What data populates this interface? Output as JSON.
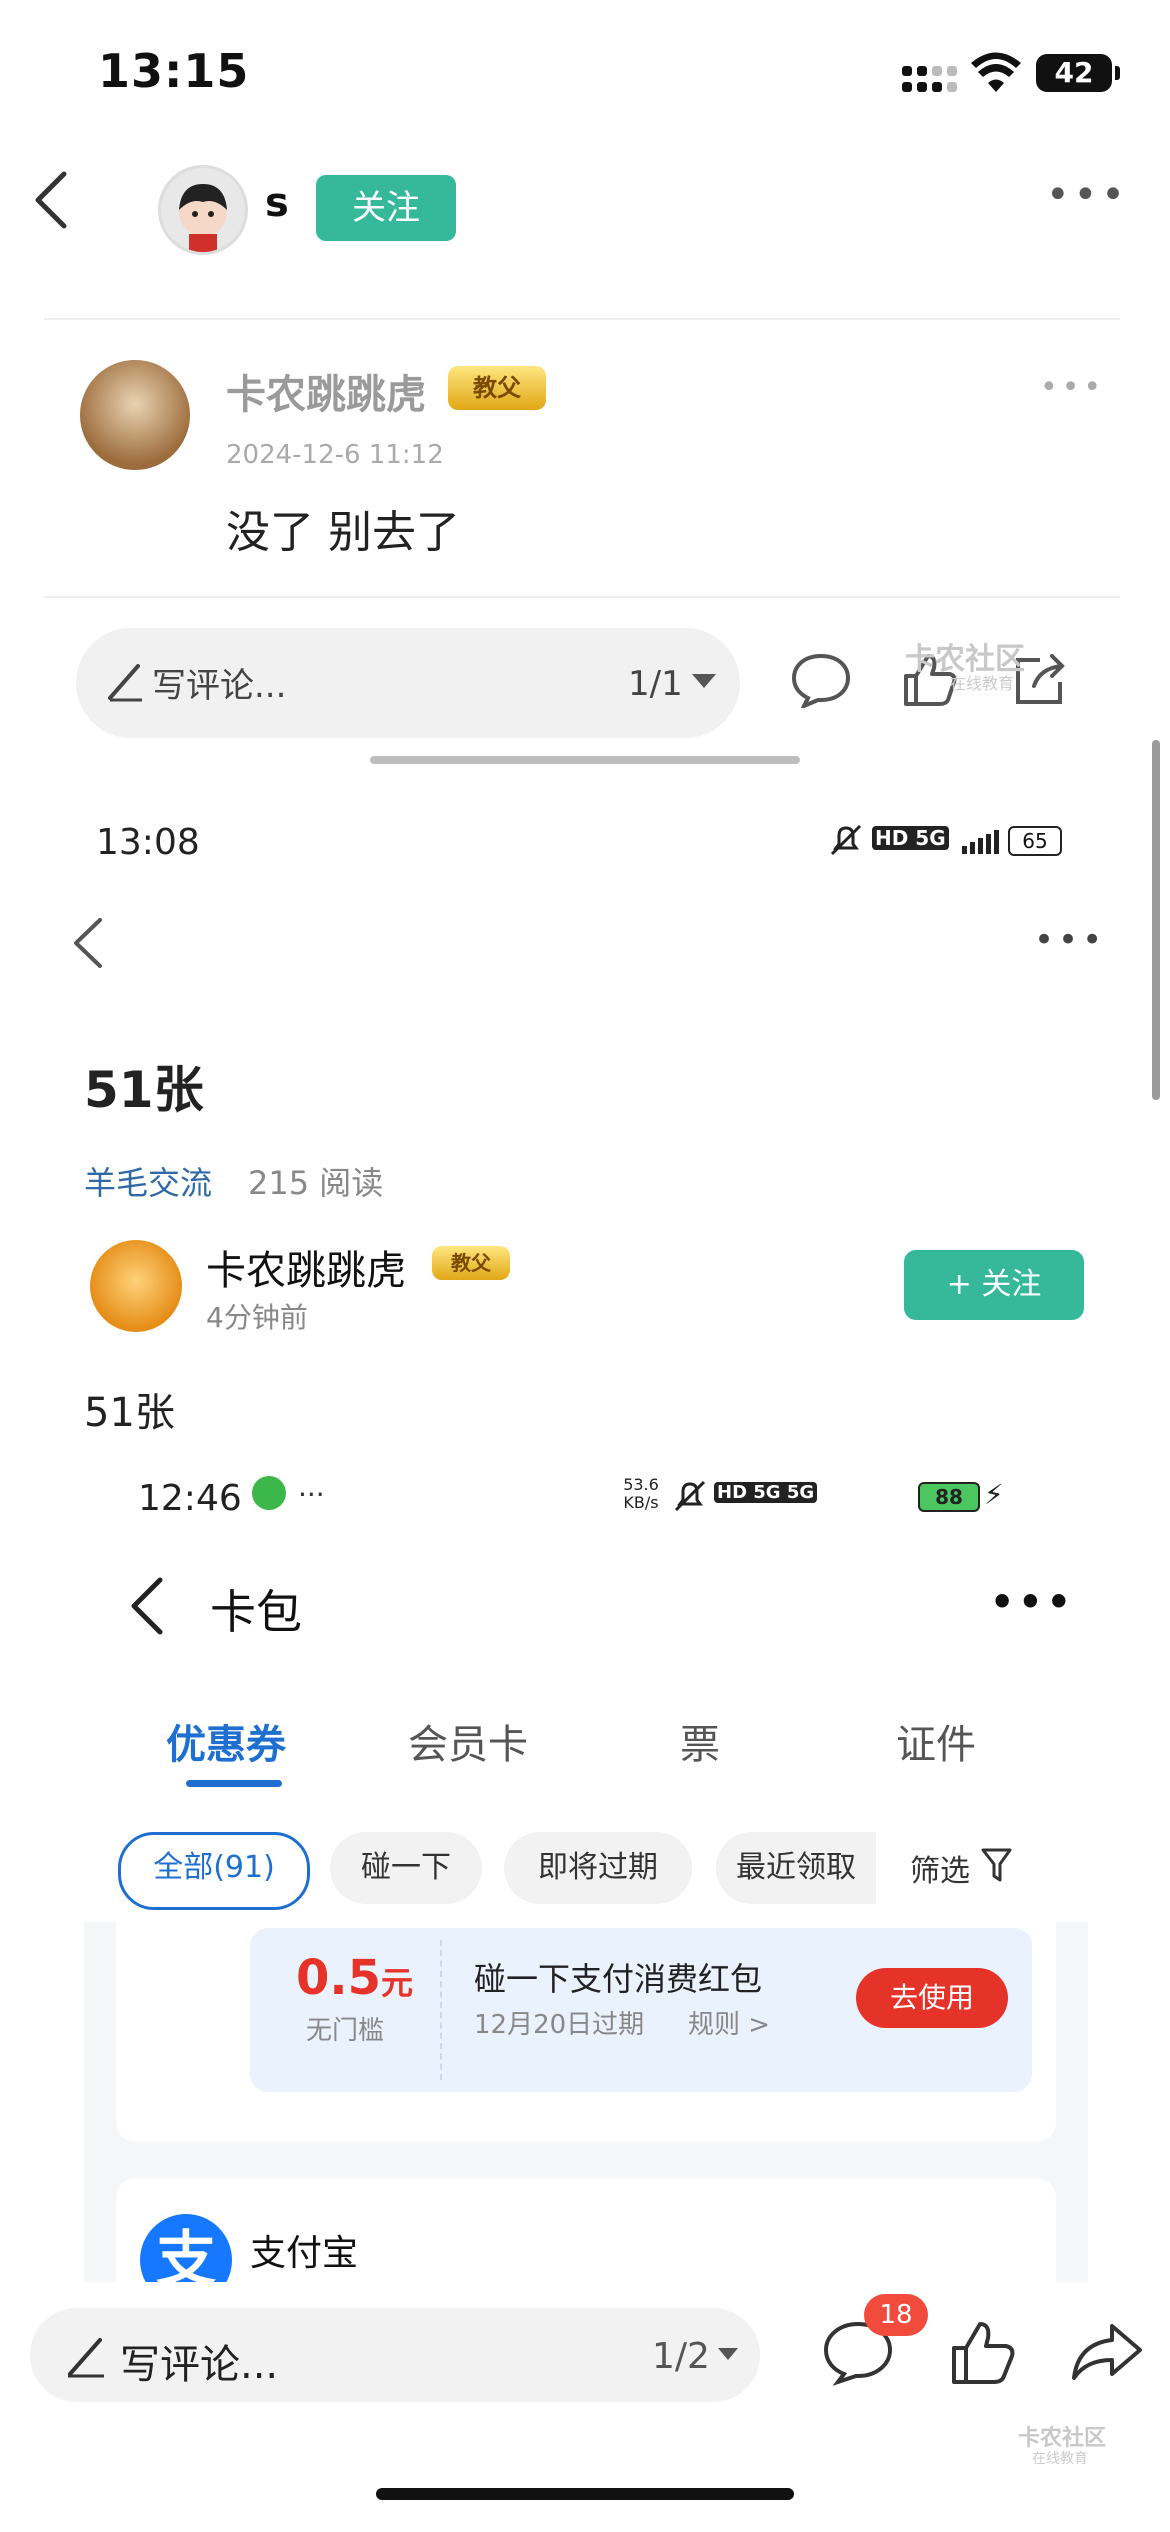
{
  "status_bar": {
    "time": "13:15",
    "battery": "42"
  },
  "header": {
    "username": "s",
    "follow_label": "关注"
  },
  "comment": {
    "author": "卡农跳跳虎",
    "badge": "教父",
    "date": "2024-12-6 11:12",
    "text": "没了 别去了"
  },
  "comment_bar_1": {
    "placeholder": "写评论...",
    "page": "1/1"
  },
  "watermark": {
    "text": "卡农社区",
    "sub": "在线教育"
  },
  "embedded_post": {
    "status_time": "13:08",
    "status_indicators": "HD 5G",
    "battery": "65",
    "title": "51张",
    "board": "羊毛交流",
    "reads": "215 阅读",
    "author": "卡农跳跳虎",
    "badge": "教父",
    "time_ago": "4分钟前",
    "follow_label": "+ 关注",
    "body": "51张"
  },
  "embedded_wallet": {
    "status_time": "12:46",
    "net_speed": "53.6 KB/s",
    "status_indicators": "HD 5G 5G",
    "battery": "88",
    "title": "卡包",
    "tabs": [
      "优惠券",
      "会员卡",
      "票",
      "证件"
    ],
    "active_tab": 0,
    "filters": [
      "全部(91)",
      "碰一下",
      "即将过期",
      "最近领取",
      "筛选"
    ],
    "coupon": {
      "amount": "0.5",
      "unit": "元",
      "condition": "无门槛",
      "title": "碰一下支付消费红包",
      "expires": "12月20日过期",
      "rule": "规则 >",
      "button": "去使用"
    },
    "merchant": "支付宝",
    "merchant_logo_char": "支"
  },
  "comment_bar_2": {
    "placeholder": "写评论...",
    "page": "1/2",
    "comment_count": "18"
  },
  "colors": {
    "accent_green": "#35b99a",
    "link_blue": "#1f6fd0",
    "red": "#e5332a"
  }
}
